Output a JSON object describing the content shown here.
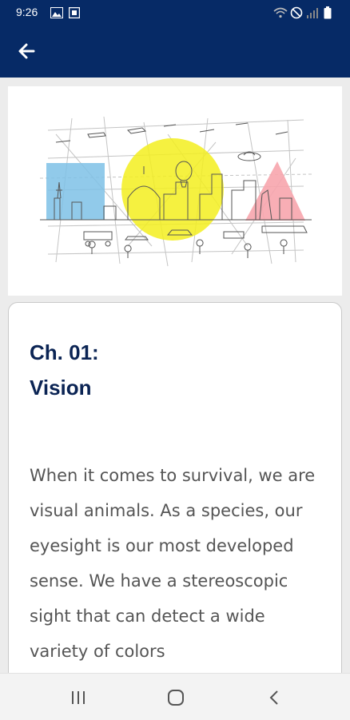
{
  "status_bar": {
    "time": "9:26",
    "left_icons": [
      "image-icon",
      "square-notification-icon"
    ],
    "right_icons": [
      "wifi-icon",
      "do-not-disturb-icon",
      "signal-icon",
      "battery-icon"
    ]
  },
  "app_bar": {
    "color": "#062a66",
    "back_icon": "arrow-left-icon"
  },
  "hero": {
    "illustration": "city-sketch-illustration",
    "shapes": [
      "blue-square",
      "yellow-circle",
      "pink-triangle"
    ]
  },
  "chapter": {
    "number": "Ch. 01:",
    "title": "Vision",
    "body": "When it comes to survival, we are visual animals. As a species, our eyesight is our most developed sense. We have a stereoscopic sight that can detect a wide variety of colors"
  },
  "nav_bar": {
    "icons": [
      "recents-icon",
      "home-icon",
      "back-icon"
    ]
  }
}
